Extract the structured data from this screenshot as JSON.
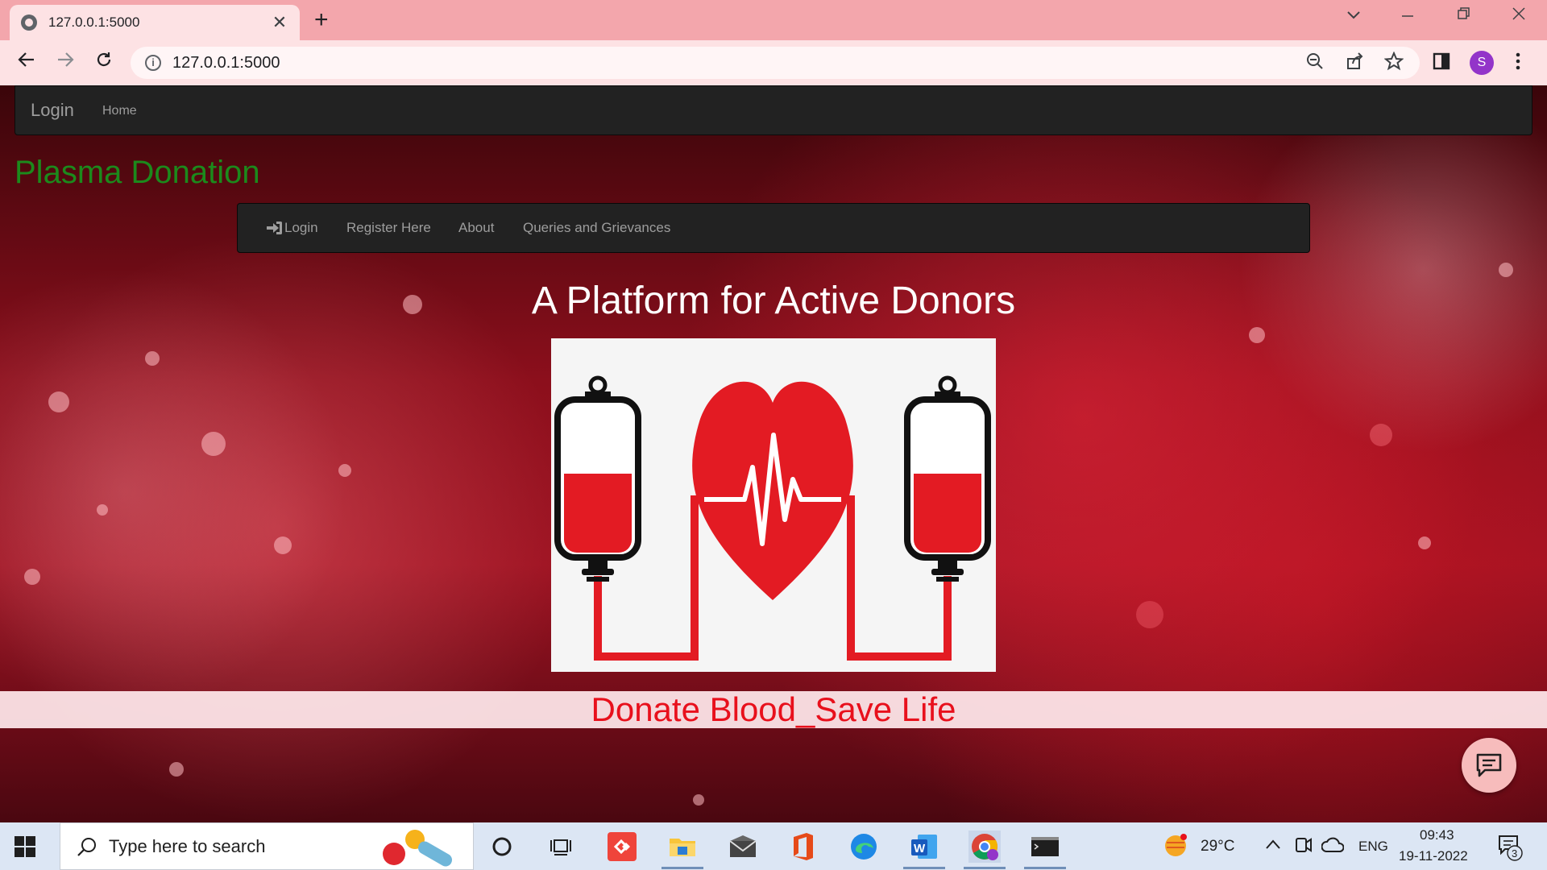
{
  "browser": {
    "tab_title": "127.0.0.1:5000",
    "tab_close": "✕",
    "new_tab": "+",
    "url": "127.0.0.1:5000",
    "profile_initial": "S",
    "info_glyph": "i"
  },
  "top_nav": {
    "brand": "Login",
    "home": "Home"
  },
  "site_title": "Plasma Donation",
  "sub_nav": {
    "items": [
      "Login",
      "Register Here",
      "About",
      "Queries and Grievances"
    ]
  },
  "headline": "A Platform for Active Donors",
  "hero_image": {
    "icons": [
      "blood-bag-icon",
      "heart-pulse-icon",
      "blood-bag-icon"
    ]
  },
  "tagline": "Donate Blood_Save Life",
  "chat_icon": "chat-icon",
  "taskbar": {
    "search_placeholder": "Type here to search",
    "weather": "29°C",
    "language": "ENG",
    "time": "09:43",
    "date": "19-11-2022",
    "notification_count": "3"
  },
  "colors": {
    "accent_green": "#1c8a1c",
    "tagline_red": "#e8101c",
    "navbar": "#222222",
    "chrome_pink": "#f3a6ac"
  }
}
